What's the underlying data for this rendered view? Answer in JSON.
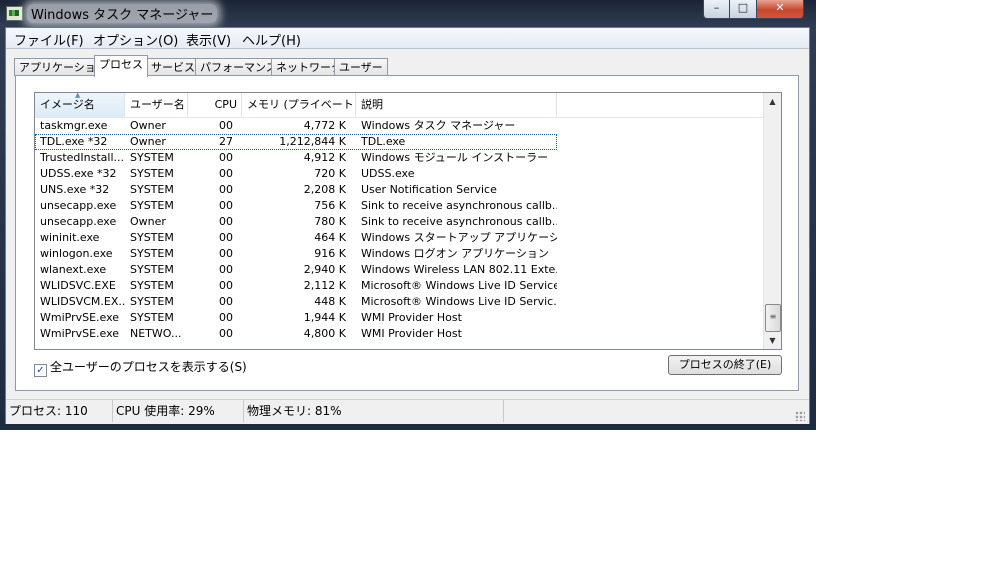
{
  "window": {
    "title": "Windows タスク マネージャー",
    "min_label": "–",
    "max_label": "□",
    "close_label": "✕"
  },
  "menu": [
    "ファイル(F)",
    "オプション(O)",
    "表示(V)",
    "ヘルプ(H)"
  ],
  "tabs": [
    {
      "label": "アプリケーション",
      "active": false
    },
    {
      "label": "プロセス",
      "active": true
    },
    {
      "label": "サービス",
      "active": false
    },
    {
      "label": "パフォーマンス",
      "active": false
    },
    {
      "label": "ネットワーク",
      "active": false
    },
    {
      "label": "ユーザー",
      "active": false
    }
  ],
  "columns": {
    "name": "イメージ名",
    "user": "ユーザー名",
    "cpu": "CPU",
    "mem": "メモリ (プライベート ...",
    "desc": "説明"
  },
  "rows": [
    {
      "name": "taskmgr.exe",
      "user": "Owner",
      "cpu": "00",
      "mem": "4,772 K",
      "desc": "Windows タスク マネージャー"
    },
    {
      "name": "TDL.exe *32",
      "user": "Owner",
      "cpu": "27",
      "mem": "1,212,844 K",
      "desc": "TDL.exe"
    },
    {
      "name": "TrustedInstall...",
      "user": "SYSTEM",
      "cpu": "00",
      "mem": "4,912 K",
      "desc": "Windows モジュール インストーラー"
    },
    {
      "name": "UDSS.exe *32",
      "user": "SYSTEM",
      "cpu": "00",
      "mem": "720 K",
      "desc": "UDSS.exe"
    },
    {
      "name": "UNS.exe *32",
      "user": "SYSTEM",
      "cpu": "00",
      "mem": "2,208 K",
      "desc": "User Notification Service"
    },
    {
      "name": "unsecapp.exe",
      "user": "SYSTEM",
      "cpu": "00",
      "mem": "756 K",
      "desc": "Sink to receive asynchronous callb..."
    },
    {
      "name": "unsecapp.exe",
      "user": "Owner",
      "cpu": "00",
      "mem": "780 K",
      "desc": "Sink to receive asynchronous callb..."
    },
    {
      "name": "wininit.exe",
      "user": "SYSTEM",
      "cpu": "00",
      "mem": "464 K",
      "desc": "Windows スタートアップ アプリケーション"
    },
    {
      "name": "winlogon.exe",
      "user": "SYSTEM",
      "cpu": "00",
      "mem": "916 K",
      "desc": "Windows ログオン アプリケーション"
    },
    {
      "name": "wlanext.exe",
      "user": "SYSTEM",
      "cpu": "00",
      "mem": "2,940 K",
      "desc": "Windows Wireless LAN 802.11 Exte..."
    },
    {
      "name": "WLIDSVC.EXE",
      "user": "SYSTEM",
      "cpu": "00",
      "mem": "2,112 K",
      "desc": "Microsoft® Windows Live ID Service"
    },
    {
      "name": "WLIDSVCM.EX...",
      "user": "SYSTEM",
      "cpu": "00",
      "mem": "448 K",
      "desc": "Microsoft® Windows Live ID Servic..."
    },
    {
      "name": "WmiPrvSE.exe",
      "user": "SYSTEM",
      "cpu": "00",
      "mem": "1,944 K",
      "desc": "WMI Provider Host"
    },
    {
      "name": "WmiPrvSE.exe",
      "user": "NETWO...",
      "cpu": "00",
      "mem": "4,800 K",
      "desc": "WMI Provider Host"
    }
  ],
  "selected_row": 1,
  "show_all_users": {
    "label": "全ユーザーのプロセスを表示する(S)",
    "checked": true
  },
  "end_process_label": "プロセスの終了(E)",
  "status": {
    "processes": "プロセス: 110",
    "cpu": "CPU 使用率: 29%",
    "memory": "物理メモリ: 81%"
  }
}
